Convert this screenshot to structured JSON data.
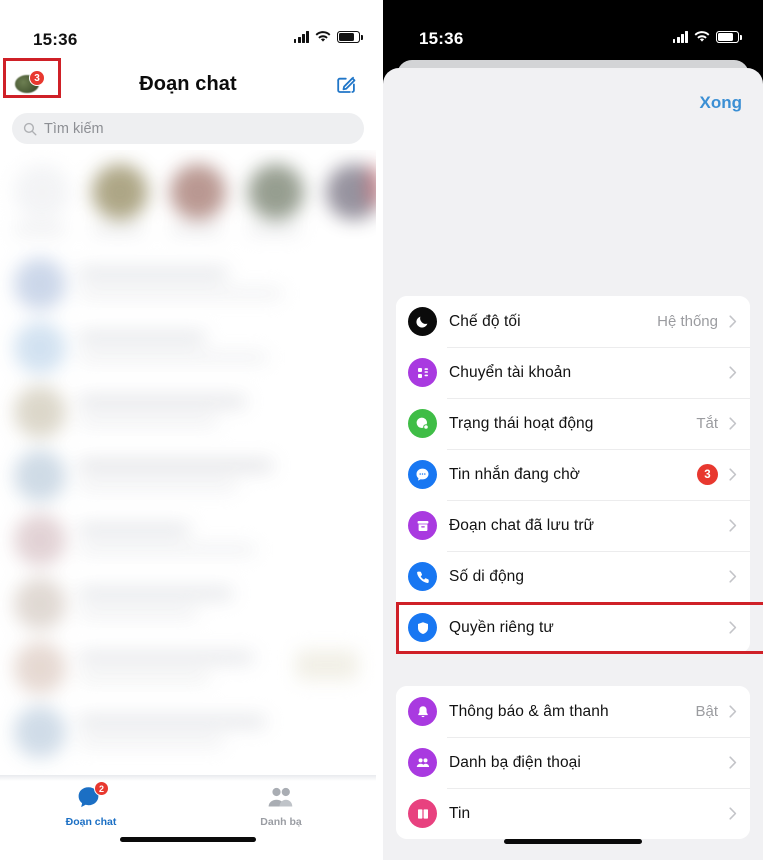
{
  "left_phone": {
    "status_bar": {
      "time": "15:36",
      "signal_icon": "cellular-signal-icon",
      "wifi_icon": "wifi-icon",
      "battery_icon": "battery-icon"
    },
    "header": {
      "title": "Đoạn chat",
      "avatar_icon": "profile-avatar",
      "avatar_badge": "3",
      "compose_icon": "compose-new-message-icon"
    },
    "search": {
      "placeholder": "Tìm kiếm",
      "icon": "search-icon"
    },
    "chat_list_state": "blurred",
    "tab_bar": {
      "tabs": [
        {
          "label": "Đoạn chat",
          "icon": "chat-bubble-icon",
          "badge": "2",
          "active": true
        },
        {
          "label": "Danh bạ",
          "icon": "contacts-people-icon",
          "badge": "",
          "active": false
        }
      ]
    }
  },
  "right_phone": {
    "status_bar": {
      "time": "15:36",
      "signal_icon": "cellular-signal-icon",
      "wifi_icon": "wifi-icon",
      "battery_icon": "battery-icon"
    },
    "sheet": {
      "done_label": "Xong",
      "groups": [
        {
          "items": [
            {
              "label": "Chế độ tối",
              "value": "Hệ thống",
              "badge": "",
              "icon": "moon-dark-mode-icon",
              "color": "#0b0b0b"
            },
            {
              "label": "Chuyển tài khoản",
              "value": "",
              "badge": "",
              "icon": "switch-account-icon",
              "color": "#a93ae0"
            },
            {
              "label": "Trạng thái hoạt động",
              "value": "Tắt",
              "badge": "",
              "icon": "active-status-icon",
              "color": "#3fbd46"
            },
            {
              "label": "Tin nhắn đang chờ",
              "value": "",
              "badge": "3",
              "icon": "message-requests-icon",
              "color": "#1877f2"
            },
            {
              "label": "Đoạn chat đã lưu trữ",
              "value": "",
              "badge": "",
              "icon": "archived-chats-icon",
              "color": "#a93ae0"
            },
            {
              "label": "Số di động",
              "value": "",
              "badge": "",
              "icon": "phone-number-icon",
              "color": "#1877f2"
            },
            {
              "label": "Quyền riêng tư",
              "value": "",
              "badge": "",
              "icon": "privacy-shield-icon",
              "color": "#1877f2"
            }
          ]
        },
        {
          "items": [
            {
              "label": "Thông báo & âm thanh",
              "value": "Bật",
              "badge": "",
              "icon": "notification-bell-icon",
              "color": "#a93ae0"
            },
            {
              "label": "Danh bạ điện thoại",
              "value": "",
              "badge": "",
              "icon": "phone-contacts-icon",
              "color": "#a93ae0"
            },
            {
              "label": "Tin",
              "value": "",
              "badge": "",
              "icon": "stories-news-icon",
              "color": "#e8417f"
            }
          ]
        }
      ]
    }
  },
  "annotations": {
    "highlight_color": "#cf2027",
    "boxes": [
      {
        "name": "avatar-highlight",
        "target": "left profile avatar with badge 3"
      },
      {
        "name": "privacy-highlight",
        "target": "Quyền riêng tư row"
      }
    ]
  }
}
